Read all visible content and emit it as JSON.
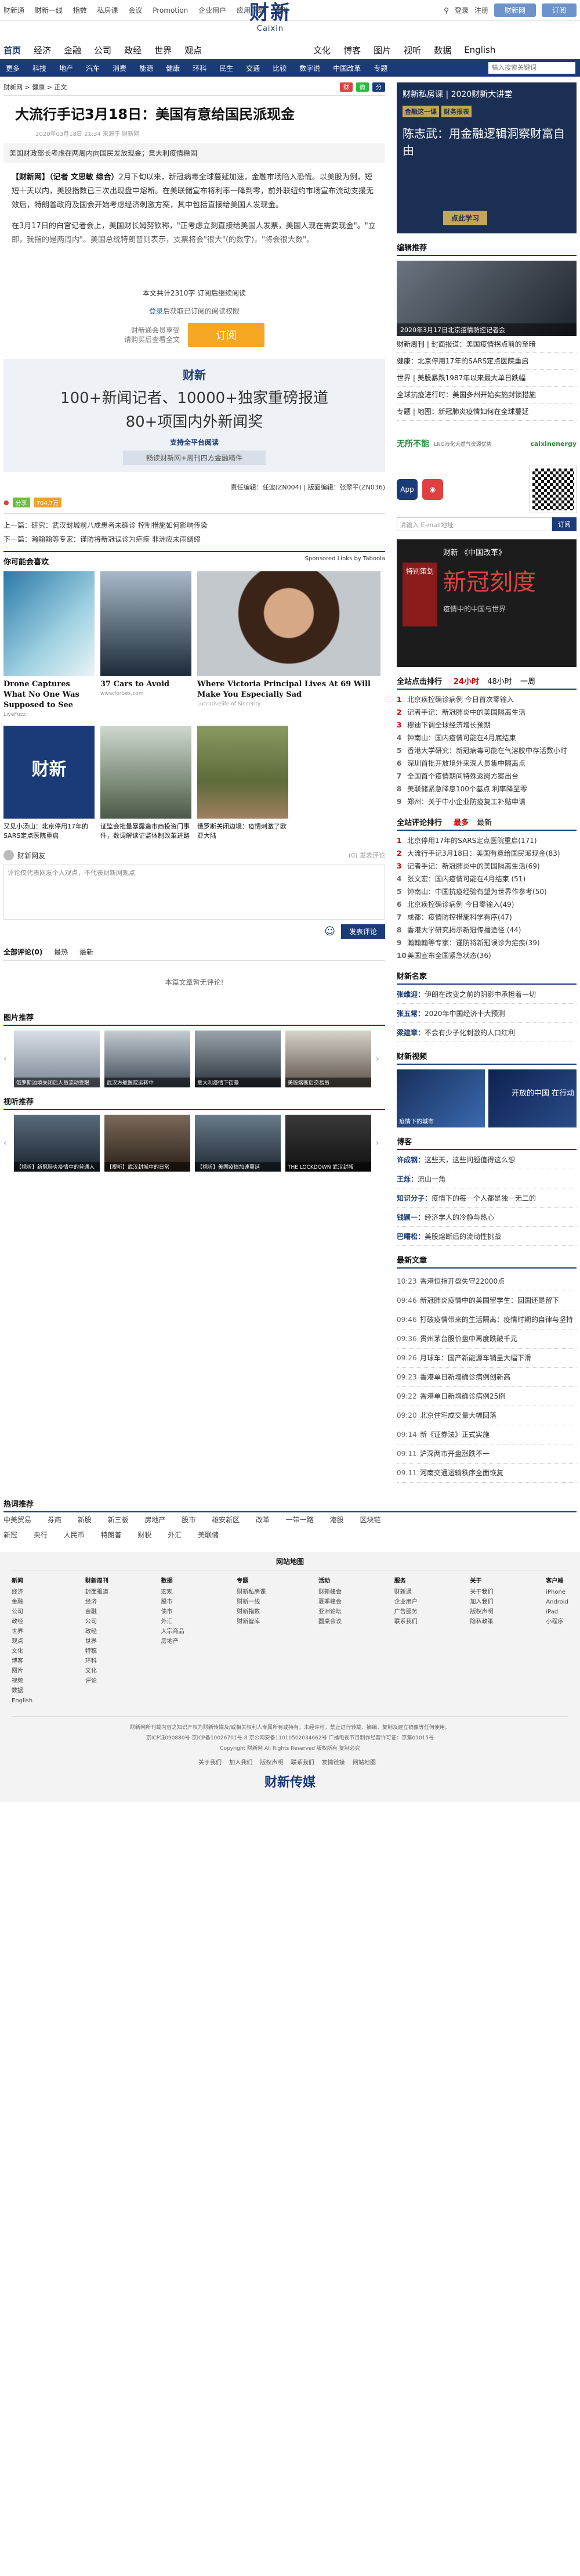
{
  "topbar": {
    "links": [
      "财新通",
      "财新一线",
      "指数",
      "私房课",
      "会议",
      "Promotion",
      "企业用户",
      "应用下载",
      "帮助"
    ],
    "login": "登录",
    "register": "注册",
    "btn1": "财新网",
    "btn2": "订阅"
  },
  "logo": {
    "cn": "财新",
    "en": "Caixin"
  },
  "channels": [
    "首页",
    "经济",
    "金融",
    "公司",
    "政经",
    "世界",
    "观点"
  ],
  "channels_right": [
    "文化",
    "博客",
    "图片",
    "视听",
    "数据",
    "English"
  ],
  "subnav": [
    "更多",
    "科技",
    "地产",
    "汽车",
    "消费",
    "能源",
    "健康",
    "环科",
    "民生",
    "交通",
    "比较",
    "数字说",
    "比较",
    "中国改革",
    "专题"
  ],
  "subnav_search": "输入搜索关键词",
  "crumbs": {
    "path": "财新网 > 健康 > 正文",
    "badge1": "财",
    "badge2": "微",
    "badge3": "分"
  },
  "article": {
    "title": "大流行手记3月18日：美国有意给国民派现金",
    "meta": "2020年03月18日 21:34  来源于 财新网",
    "summary": "美国财政部长考虑在两周内向国民发放现金；意大利疫情稳固",
    "p1_lead": "【财新网】（记者 文思敏 综合）",
    "p1": "2月下旬以来，新冠病毒全球蔓延加速，金融市场陷入恐慌。以美股为例，短短十天以内，美股指数已三次出现盘中熔断。在美联储宣布将利率一降到零，前外联纽约市场宣布流动支援无效后，特朗普政府及国会开始考虑经济刺激方案，其中包括直接给美国人发现金。",
    "p2": "在3月17日的白宫记者会上，美国财长姆努钦称，\"正考虑立刻直接给美国人发票，美国人现在需要现金\"。\"立即，我指的是两周内\"。美国总统特朗普则表示，支票将会\"很大\"(的数字)，\"将会很大数\"。",
    "readline": "本文共计2310字 订阅后继续阅读",
    "login_hint_link": "登录",
    "login_hint": "后获取已订阅的阅读权限",
    "sub_text1": "财新通会员享受",
    "sub_text2": "请购买后查看全文",
    "sub_btn": "订阅"
  },
  "promo": {
    "logo": "财新",
    "line1": "100+新闻记者、10000+独家重磅报道",
    "line2": "80+项国内外新闻奖",
    "line3": "支持全平台阅读",
    "line4": "畅读财新网+周刊四方金融精件"
  },
  "editor": "责任编辑：任波(ZN004) | 版面编辑：张翠平(ZN036)",
  "share": {
    "tag": "分享",
    "count": "704.7万"
  },
  "prevnext": {
    "prev": "上一篇：研究：武汉封城前八成患者未确诊 控制措施如何影响传染",
    "next": "下一篇：瀚翰翰等专家：谨防将新冠误诊为疟疾 非洲应未雨绸缪"
  },
  "maylike": {
    "title": "你可能会喜欢",
    "sponsor": "Sponsored Links by Taboola"
  },
  "ads": [
    {
      "cap": "Drone Captures What No One Was Supposed to See",
      "src": "LiveFuzz"
    },
    {
      "cap": "37 Cars to Avoid",
      "src": "www.forbes.com"
    },
    {
      "cap": "Where Victoria Principal Lives At 69 Will Make You Especially Sad",
      "src": "Lucrativelife of Sincerity"
    }
  ],
  "related": [
    {
      "cap": "又见小汤山：北京停用17年的SARS定点医院重启"
    },
    {
      "cap": "证监会批量暴露造市商投资门事件，数调解读证监体制改革进路"
    },
    {
      "cap": "俄罗斯关闭边境：疫情刺激了欧亚大陆"
    },
    {
      "cap": "俄罗斯关闭边境 疫情下的生活与应对措施"
    }
  ],
  "comment": {
    "user": "财新网友",
    "right": "(0)  发表评论",
    "placeholder": "评论仅代表网友个人观点，不代表财新网观点",
    "post": "发表评论",
    "tabs": [
      "全部评论(0)",
      "最热",
      "最新"
    ],
    "empty": "本篇文章暂无评论!"
  },
  "gallery": {
    "title": "图片推荐",
    "items": [
      "俄罗斯边境关闭后人员流动受限",
      "武汉方舱医院运转中",
      "意大利疫情下街景",
      "美股熔断后交易员"
    ]
  },
  "video": {
    "title": "视听推荐",
    "items": [
      "【视听】新冠肺炎疫情中的普通人",
      "【视听】武汉封城中的日常",
      "【视听】美国疫情加速蔓延",
      "THE LOCKDOWN 武汉封城"
    ]
  },
  "sidebar": {
    "ad1_head": "财新私房课 | 2020财新大讲堂",
    "ad1_tag1": "金融这一课",
    "ad1_tag2": "财务报表",
    "ad1_big": "陈志武：用金融逻辑洞察财富自由",
    "ad1_btn": "点此学习",
    "editor_pick": "编辑推荐",
    "feat_cap": "2020年3月17日北京疫情防控记者会",
    "picks": [
      "财新周刊 | 封面报道：美国疫情拐点前的至暗",
      "健康：北京停用17年的SARS定点医院重启",
      "世界 | 美股暴跌1987年以来最大单日跌幅",
      "全球抗疫进行时：美国多州开始实施封锁措施",
      "专题 | 地图：新冠肺炎疫情如何在全球蔓延"
    ],
    "ad_small_left": "无所不能",
    "ad_small_sub": "LNG液化天然气资源优势",
    "ad_small_right": "caixinenergy",
    "mail_placeholder": "请输入 E-mail地址",
    "mail_btn": "订阅",
    "ad2_a": "财新 《中国改革》",
    "ad2_b": "新冠刻度",
    "ad2_c": "疫情中的中国与世界",
    "ad2_book": "特别策划",
    "hot_title": "全站点击排行",
    "hot_tabs": [
      "24小时",
      "48小时",
      "一周"
    ],
    "hot": [
      "北京疾控确诊病例 今日首次零输入",
      "记者手记：新冠肺炎中的美国隔离生活",
      "穆迪下调全球经济增长预期",
      "钟南山：国内疫情可能在4月底结束",
      "香港大学研究：新冠病毒可能在气溶胶中存活数小时",
      "深圳首批开放境外来深人员集中隔离点",
      "全国首个疫情期间特殊返岗方案出台",
      "美联储紧急降息100个基点 利率降至零",
      "郑州：关于中小企业防疫复工补贴申请"
    ],
    "cmt_title": "全站评论排行",
    "cmt_tabs": [
      "最多",
      "最新"
    ],
    "cmt": [
      "北京停用17年的SARS定点医院重启(171)",
      "大流行手记3月18日：美国有意给国民派现金(83)",
      "记者手记：新冠肺炎中的美国隔离生活(69)",
      "张文宏：国内疫情可能在4月结束 (51)",
      "钟南山：中国抗疫经验有望为世界作参考(50)",
      "北京疾控确诊病例 今日零输入(49)",
      "成都：疫情防控措施科学有序(47)",
      "香港大学研究揭示新冠传播途径 (44)",
      "瀚翰翰等专家：谨防将新冠误诊为疟疾(39)",
      "美国宣布全国紧急状态(36)"
    ],
    "opinion_title": "财新名家",
    "opinion": [
      {
        "name": "张维迎：",
        "t": "伊朗在改变之前的阴影中承担着一切"
      },
      {
        "name": "张五常：",
        "t": "2020年中国经济十大预测"
      },
      {
        "name": "梁建章：",
        "t": "不会有少子化刺激的人口红利"
      }
    ],
    "vgal_title": "财新视频",
    "vgal": [
      "疫情下的城市",
      "开放的中国 在行动"
    ],
    "blog_title": "博客",
    "blogs": [
      {
        "name": "许成钢：",
        "t": "这些天，这些问题值得这么想"
      },
      {
        "name": "王烁：",
        "t": "流山一角"
      },
      {
        "name": "知识分子：",
        "t": "疫情下的每一个人都是独一无二的"
      },
      {
        "name": "钱颖一：",
        "t": "经济学人的冷静与热心"
      },
      {
        "name": "巴曙松：",
        "t": "美股熔断后的流动性挑战"
      }
    ],
    "latest_title": "最新文章",
    "latest": [
      {
        "tm": "10:23",
        "t": "香港恒指开盘失守22000点"
      },
      {
        "tm": "09:46",
        "t": "新冠肺炎疫情中的美国留学生：回国还是留下"
      },
      {
        "tm": "09:46",
        "t": "打破疫情带来的生活隔离：疫情时期的自律与坚持"
      },
      {
        "tm": "09:36",
        "t": "贵州茅台股价盘中再度跌破千元"
      },
      {
        "tm": "09:26",
        "t": "月球车：国产新能源车销量大幅下滑"
      },
      {
        "tm": "09:23",
        "t": "香港单日新增确诊病例创新高"
      },
      {
        "tm": "09:22",
        "t": "香港单日新增确诊病例25例"
      },
      {
        "tm": "09:20",
        "t": "北京住宅成交量大幅回落"
      },
      {
        "tm": "09:14",
        "t": "新《证券法》正式实施"
      },
      {
        "tm": "09:11",
        "t": "沪深两市开盘涨跌不一"
      },
      {
        "tm": "09:11",
        "t": "河南交通运输秩序全面恢复"
      }
    ]
  },
  "hot_terms": {
    "title": "热词推荐",
    "row1": [
      "中美贸易",
      "券商",
      "新股",
      "新三板",
      "房地产",
      "股市",
      "雄安新区",
      "改革",
      "一带一路",
      "港股",
      "区块链"
    ],
    "row2": [
      "新冠",
      "央行",
      "人民币",
      "特朗普",
      "财税",
      "外汇",
      "美联储"
    ]
  },
  "footer": {
    "head": "网站地图",
    "cols": [
      {
        "h": "新闻",
        "items": [
          "经济",
          "金融",
          "公司",
          "政经",
          "世界",
          "观点",
          "文化",
          "博客",
          "图片",
          "视频",
          "数据",
          "English"
        ]
      },
      {
        "h": "财新周刊",
        "items": [
          "封面报道",
          "经济",
          "金融",
          "公司",
          "政经",
          "世界",
          "特稿",
          "环科",
          "文化",
          "评论"
        ]
      },
      {
        "h": "数据",
        "items": [
          "宏观",
          "股市",
          "债市",
          "外汇",
          "大宗商品",
          "房地产"
        ]
      },
      {
        "h": "专题",
        "items": [
          "财新私房课",
          "财新一线",
          "财新指数",
          "财新智库"
        ]
      },
      {
        "h": "活动",
        "items": [
          "财新峰会",
          "夏季峰会",
          "亚洲论坛",
          "圆桌会议"
        ]
      },
      {
        "h": "服务",
        "items": [
          "财新通",
          "企业用户",
          "广告服务",
          "联系我们"
        ]
      },
      {
        "h": "关于",
        "items": [
          "关于我们",
          "加入我们",
          "版权声明",
          "隐私政策"
        ]
      },
      {
        "h": "客户端",
        "items": [
          "iPhone",
          "Android",
          "iPad",
          "小程序"
        ]
      }
    ],
    "note1": "财新网所刊载内容之知识产权为财新传媒及/或相关权利人专属所有或持有。未经许可，禁止进行转载、摘编、复制及建立镜像等任何使用。",
    "note2": "京ICP证090880号 京ICP备10026701号-8 京公网安备11010502034662号 广播电视节目制作经营许可证：京第01015号",
    "note3": "Copyright 财新网 All Rights Reserved 版权所有 复制必究",
    "bottom": [
      "关于我们",
      "加入我们",
      "版权声明",
      "联系我们",
      "友情链接",
      "网站地图"
    ],
    "logo": "财新传媒"
  },
  "colors": {
    "brand": "#1a3a78",
    "accent": "#f5a623",
    "red": "#c00000"
  }
}
